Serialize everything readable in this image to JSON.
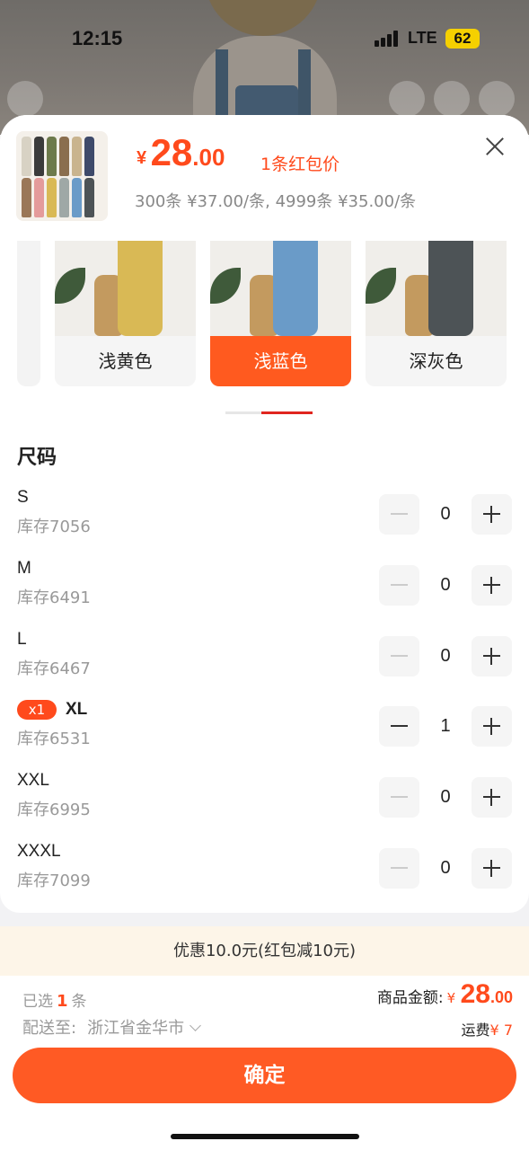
{
  "status_bar": {
    "time": "12:15",
    "network": "LTE",
    "battery": "62"
  },
  "product": {
    "currency": "¥",
    "price_int": "28",
    "price_dec": ".00",
    "price_note": "1条红包价",
    "tier_text": "300条 ¥37.00/条, 4999条 ¥35.00/条"
  },
  "colors": [
    {
      "label": "浅黄色",
      "swatch": "#d9b955",
      "selected": false
    },
    {
      "label": "浅蓝色",
      "swatch": "#6a9bc8",
      "selected": true
    },
    {
      "label": "深灰色",
      "swatch": "#4d5356",
      "selected": false
    }
  ],
  "size_section": {
    "title": "尺码"
  },
  "sizes": [
    {
      "name": "S",
      "stock": "库存7056",
      "qty": "0",
      "selected_badge": ""
    },
    {
      "name": "M",
      "stock": "库存6491",
      "qty": "0",
      "selected_badge": ""
    },
    {
      "name": "L",
      "stock": "库存6467",
      "qty": "0",
      "selected_badge": ""
    },
    {
      "name": "XL",
      "stock": "库存6531",
      "qty": "1",
      "selected_badge": "x1"
    },
    {
      "name": "XXL",
      "stock": "库存6995",
      "qty": "0",
      "selected_badge": ""
    },
    {
      "name": "XXXL",
      "stock": "库存7099",
      "qty": "0",
      "selected_badge": ""
    }
  ],
  "discount": {
    "text": "优惠10.0元(红包减10元)"
  },
  "footer": {
    "selected_prefix": "已选",
    "selected_count": "1",
    "selected_suffix": "条",
    "ship_label": "配送至:",
    "ship_address": "浙江省金华市",
    "amount_label": "商品金额:",
    "amount_currency": "¥",
    "amount_int": "28",
    "amount_dec": ".00",
    "freight_label": "运费",
    "freight_value": "¥ 7",
    "confirm_label": "确定"
  },
  "accent_color": "#ff5a24"
}
